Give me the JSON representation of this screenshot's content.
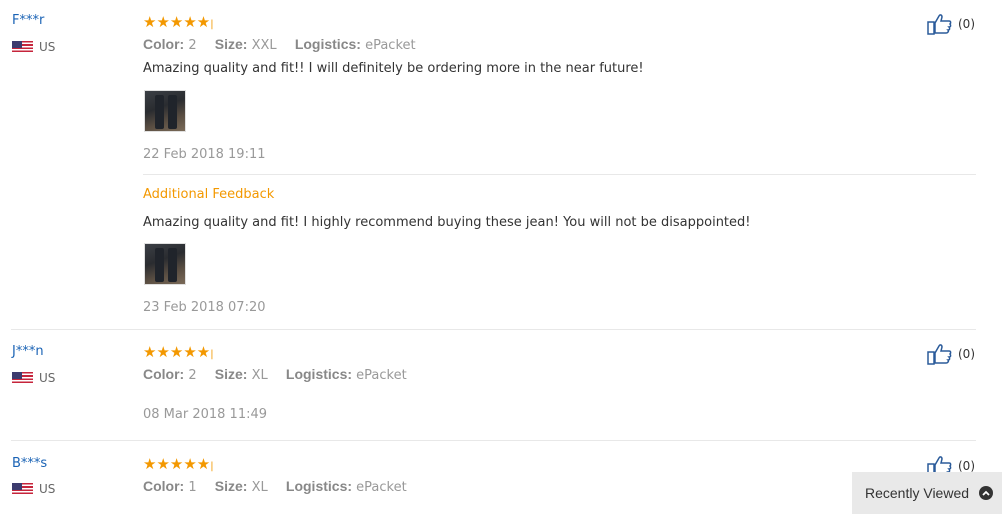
{
  "labels": {
    "color": "Color:",
    "size": "Size:",
    "logistics": "Logistics:"
  },
  "reviews": [
    {
      "user": "F***r",
      "country": "US",
      "stars": "★★★★★",
      "color": "2",
      "size": "XXL",
      "logistics": "ePacket",
      "text": "Amazing quality and fit!! I will definitely be ordering more in the near future!",
      "date": "22 Feb 2018 19:11",
      "helpful": "(0)",
      "additional": {
        "title": "Additional Feedback",
        "text": "Amazing quality and fit! I highly recommend buying these jean! You will not be disappointed!",
        "date": "23 Feb 2018 07:20"
      }
    },
    {
      "user": "J***n",
      "country": "US",
      "stars": "★★★★★",
      "color": "2",
      "size": "XL",
      "logistics": "ePacket",
      "date": "08 Mar 2018 11:49",
      "helpful": "(0)"
    },
    {
      "user": "B***s",
      "country": "US",
      "stars": "★★★★★",
      "color": "1",
      "size": "XL",
      "logistics": "ePacket",
      "helpful": "(0)"
    }
  ],
  "recently_viewed": {
    "label": "Recently Viewed"
  },
  "colors": {
    "star": "#f39800",
    "user": "#1a63b5",
    "accent_title": "#f39800"
  }
}
